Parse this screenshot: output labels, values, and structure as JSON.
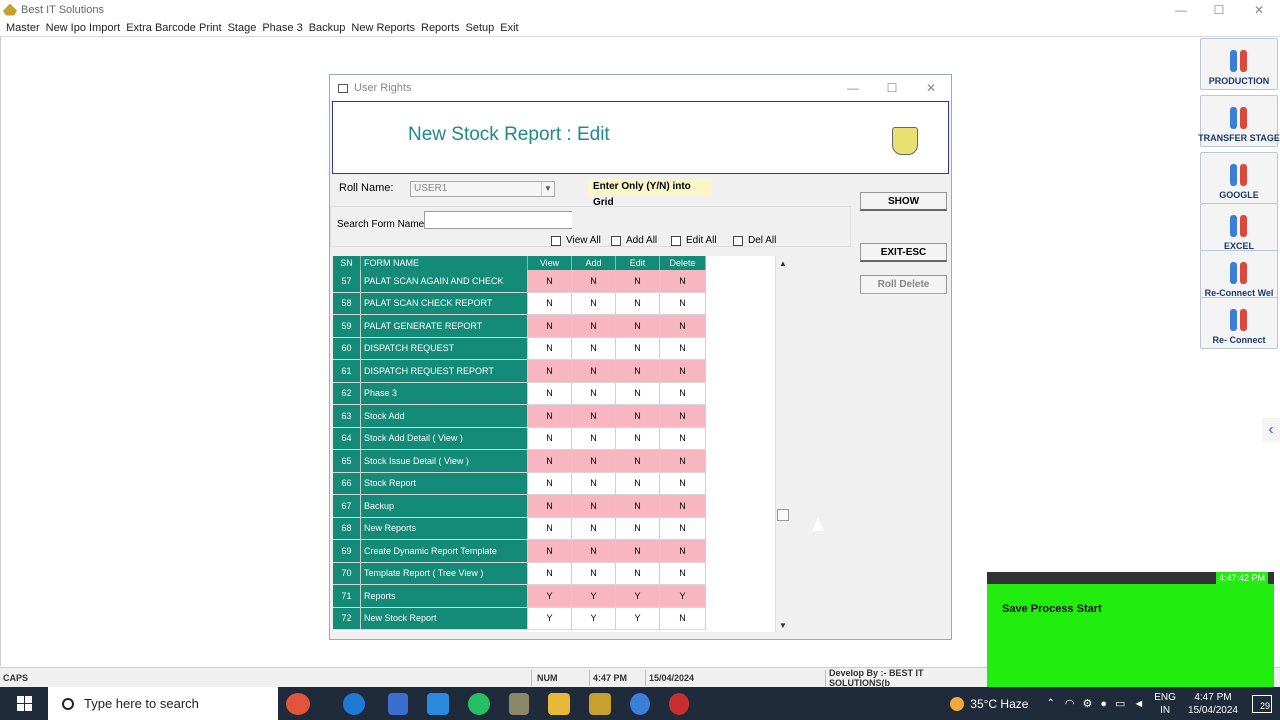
{
  "app": {
    "title": "Best IT Solutions"
  },
  "menu": [
    "Master",
    "New Ipo Import",
    "Extra Barcode Print",
    "Stage",
    "Phase 3",
    "Backup",
    "New Reports",
    "Reports",
    "Setup",
    "Exit"
  ],
  "window_controls": {
    "minimize": "—",
    "maximize": "☐",
    "close": "✕"
  },
  "right_panel": [
    {
      "label": "PRODUCTION"
    },
    {
      "label": "TRANSFER STAGE"
    },
    {
      "label": "GOOGLE"
    },
    {
      "label": "EXCEL"
    },
    {
      "label": "Re-Connect Wel"
    },
    {
      "label": "Re- Connect"
    }
  ],
  "dialog": {
    "title": "User Rights",
    "heading": "New Stock Report : Edit",
    "roll_label": "Roll Name:",
    "roll_value": "USER1",
    "hint": "Enter Only (Y/N) into Grid",
    "search_label": "Search Form Name",
    "search_value": "",
    "checks": {
      "view_all": "View All",
      "add_all": "Add All",
      "edit_all": "Edit All",
      "del_all": "Del All"
    },
    "buttons": {
      "show": "SHOW",
      "exit": "EXIT-ESC",
      "roll_delete": "Roll Delete"
    }
  },
  "grid": {
    "headers": [
      "SN",
      "FORM NAME",
      "View",
      "Add",
      "Edit",
      "Delete"
    ],
    "rows": [
      {
        "sn": "57",
        "name": "PALAT SCAN AGAIN AND CHECK",
        "view": "N",
        "add": "N",
        "edit": "N",
        "del": "N"
      },
      {
        "sn": "58",
        "name": "PALAT SCAN  CHECK REPORT",
        "view": "N",
        "add": "N",
        "edit": "N",
        "del": "N"
      },
      {
        "sn": "59",
        "name": "PALAT GENERATE  REPORT",
        "view": "N",
        "add": "N",
        "edit": "N",
        "del": "N"
      },
      {
        "sn": "60",
        "name": "DISPATCH REQUEST",
        "view": "N",
        "add": "N",
        "edit": "N",
        "del": "N"
      },
      {
        "sn": "61",
        "name": "DISPATCH REQUEST REPORT",
        "view": "N",
        "add": "N",
        "edit": "N",
        "del": "N"
      },
      {
        "sn": "62",
        "name": "Phase 3",
        "view": "N",
        "add": "N",
        "edit": "N",
        "del": "N"
      },
      {
        "sn": "63",
        "name": "Stock Add",
        "view": "N",
        "add": "N",
        "edit": "N",
        "del": "N"
      },
      {
        "sn": "64",
        "name": "Stock Add Detail ( View )",
        "view": "N",
        "add": "N",
        "edit": "N",
        "del": "N"
      },
      {
        "sn": "65",
        "name": "Stock Issue Detail ( View )",
        "view": "N",
        "add": "N",
        "edit": "N",
        "del": "N"
      },
      {
        "sn": "66",
        "name": "Stock Report",
        "view": "N",
        "add": "N",
        "edit": "N",
        "del": "N"
      },
      {
        "sn": "67",
        "name": "Backup",
        "view": "N",
        "add": "N",
        "edit": "N",
        "del": "N"
      },
      {
        "sn": "68",
        "name": "New Reports",
        "view": "N",
        "add": "N",
        "edit": "N",
        "del": "N"
      },
      {
        "sn": "69",
        "name": "Create Dynamic Report Template",
        "view": "N",
        "add": "N",
        "edit": "N",
        "del": "N"
      },
      {
        "sn": "70",
        "name": "Template Report ( Tree View )",
        "view": "N",
        "add": "N",
        "edit": "N",
        "del": "N"
      },
      {
        "sn": "71",
        "name": "Reports",
        "view": "Y",
        "add": "Y",
        "edit": "Y",
        "del": "Y"
      },
      {
        "sn": "72",
        "name": "New Stock Report",
        "view": "Y",
        "add": "Y",
        "edit": "Y",
        "del": "N"
      }
    ],
    "pink": "#f8b6c0",
    "teal": "#148a78"
  },
  "statusbar": {
    "caps": "CAPS",
    "num": "NUM",
    "time": "4:47 PM",
    "date": "15/04/2024",
    "dev": "Develop By :- BEST IT SOLUTIONS(b"
  },
  "popup": {
    "time": "4:47:42 PM",
    "message": "Save Process Start"
  },
  "taskbar": {
    "search_placeholder": "Type here to search",
    "weather": "35°C  Haze",
    "lang1": "ENG",
    "lang2": "IN",
    "clock_time": "4:47 PM",
    "clock_date": "15/04/2024",
    "notif": "29"
  }
}
